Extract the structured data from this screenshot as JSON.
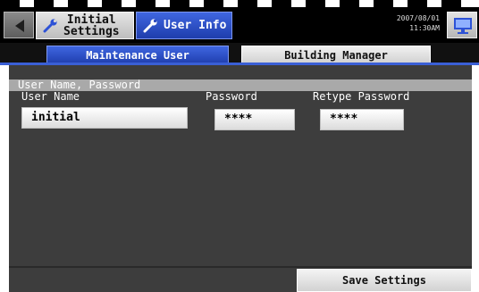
{
  "header": {
    "crumb_initial_line1": "Initial",
    "crumb_initial_line2": "Settings",
    "crumb_user": "User Info",
    "date": "2007/08/01",
    "time": "11:30AM"
  },
  "tabs": {
    "maintenance": "Maintenance User",
    "building": "Building Manager"
  },
  "section": {
    "title": "User Name, Password"
  },
  "fields": {
    "username_label": "User Name",
    "username_value": "initial",
    "password_label": "Password",
    "password_value": "****",
    "retype_label": "Retype Password",
    "retype_value": "****"
  },
  "footer": {
    "save_label": "Save Settings"
  },
  "colors": {
    "accent_blue": "#2f50c8",
    "panel_gray": "#3d3d3d",
    "header_gray": "#a9a9a9"
  },
  "icons": [
    "back-arrow-icon",
    "wrench-icon",
    "monitor-icon"
  ]
}
